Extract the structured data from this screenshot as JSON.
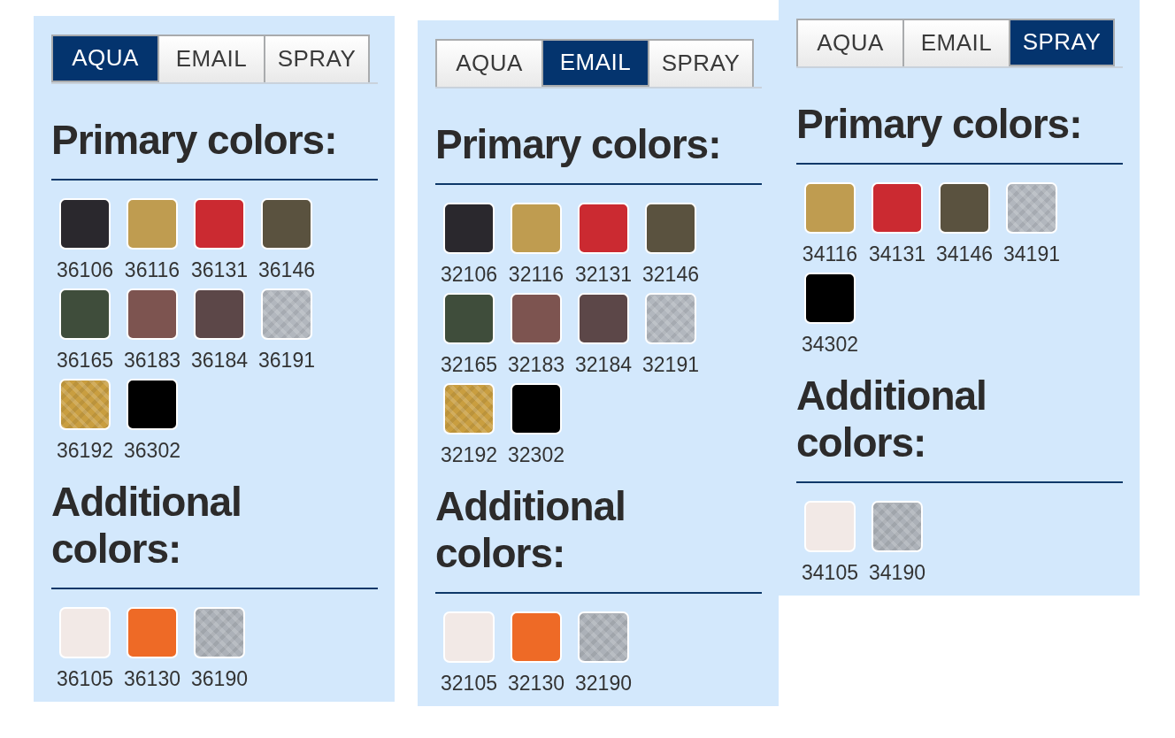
{
  "panels": [
    {
      "tabs": [
        {
          "label": "AQUA",
          "selected": true
        },
        {
          "label": "EMAIL",
          "selected": false
        },
        {
          "label": "SPRAY",
          "selected": false
        }
      ],
      "sections": [
        {
          "heading": "Primary colors:",
          "swatches": [
            {
              "code": "36106",
              "color": "#2a282d",
              "kind": "solid"
            },
            {
              "code": "36116",
              "color": "#bf9c50",
              "kind": "solid"
            },
            {
              "code": "36131",
              "color": "#cb2a31",
              "kind": "solid"
            },
            {
              "code": "36146",
              "color": "#5a523f",
              "kind": "solid"
            },
            {
              "code": "36165",
              "color": "#3f4d3b",
              "kind": "solid"
            },
            {
              "code": "36183",
              "color": "#7d5450",
              "kind": "solid"
            },
            {
              "code": "36184",
              "color": "#5c4748",
              "kind": "solid"
            },
            {
              "code": "36191",
              "color": "#b2b7be",
              "kind": "metallic"
            },
            {
              "code": "36192",
              "color": "#c99e40",
              "kind": "metallic"
            },
            {
              "code": "36302",
              "color": "#000000",
              "kind": "solid"
            }
          ]
        },
        {
          "heading": "Additional colors:",
          "swatches": [
            {
              "code": "36105",
              "color": "#f2e9e6",
              "kind": "solid"
            },
            {
              "code": "36130",
              "color": "#ee6a26",
              "kind": "solid"
            },
            {
              "code": "36190",
              "color": "#acb1b8",
              "kind": "metallic"
            }
          ]
        }
      ]
    },
    {
      "tabs": [
        {
          "label": "AQUA",
          "selected": false
        },
        {
          "label": "EMAIL",
          "selected": true
        },
        {
          "label": "SPRAY",
          "selected": false
        }
      ],
      "sections": [
        {
          "heading": "Primary colors:",
          "swatches": [
            {
              "code": "32106",
              "color": "#2a282d",
              "kind": "solid"
            },
            {
              "code": "32116",
              "color": "#bf9c50",
              "kind": "solid"
            },
            {
              "code": "32131",
              "color": "#cb2a31",
              "kind": "solid"
            },
            {
              "code": "32146",
              "color": "#5a523f",
              "kind": "solid"
            },
            {
              "code": "32165",
              "color": "#3f4d3b",
              "kind": "solid"
            },
            {
              "code": "32183",
              "color": "#7d5450",
              "kind": "solid"
            },
            {
              "code": "32184",
              "color": "#5c4748",
              "kind": "solid"
            },
            {
              "code": "32191",
              "color": "#b2b7be",
              "kind": "metallic"
            },
            {
              "code": "32192",
              "color": "#c99e40",
              "kind": "metallic"
            },
            {
              "code": "32302",
              "color": "#000000",
              "kind": "solid"
            }
          ]
        },
        {
          "heading": "Additional colors:",
          "swatches": [
            {
              "code": "32105",
              "color": "#f2e9e6",
              "kind": "solid"
            },
            {
              "code": "32130",
              "color": "#ee6a26",
              "kind": "solid"
            },
            {
              "code": "32190",
              "color": "#acb1b8",
              "kind": "metallic"
            }
          ]
        }
      ]
    },
    {
      "tabs": [
        {
          "label": "AQUA",
          "selected": false
        },
        {
          "label": "EMAIL",
          "selected": false
        },
        {
          "label": "SPRAY",
          "selected": true
        }
      ],
      "sections": [
        {
          "heading": "Primary colors:",
          "swatches": [
            {
              "code": "34116",
              "color": "#bf9c50",
              "kind": "solid"
            },
            {
              "code": "34131",
              "color": "#cb2a31",
              "kind": "solid"
            },
            {
              "code": "34146",
              "color": "#5a523f",
              "kind": "solid"
            },
            {
              "code": "34191",
              "color": "#b2b7be",
              "kind": "metallic"
            },
            {
              "code": "34302",
              "color": "#000000",
              "kind": "solid"
            }
          ]
        },
        {
          "heading": "Additional colors:",
          "swatches": [
            {
              "code": "34105",
              "color": "#f2e9e6",
              "kind": "solid"
            },
            {
              "code": "34190",
              "color": "#acb1b8",
              "kind": "metallic"
            }
          ]
        }
      ]
    }
  ]
}
